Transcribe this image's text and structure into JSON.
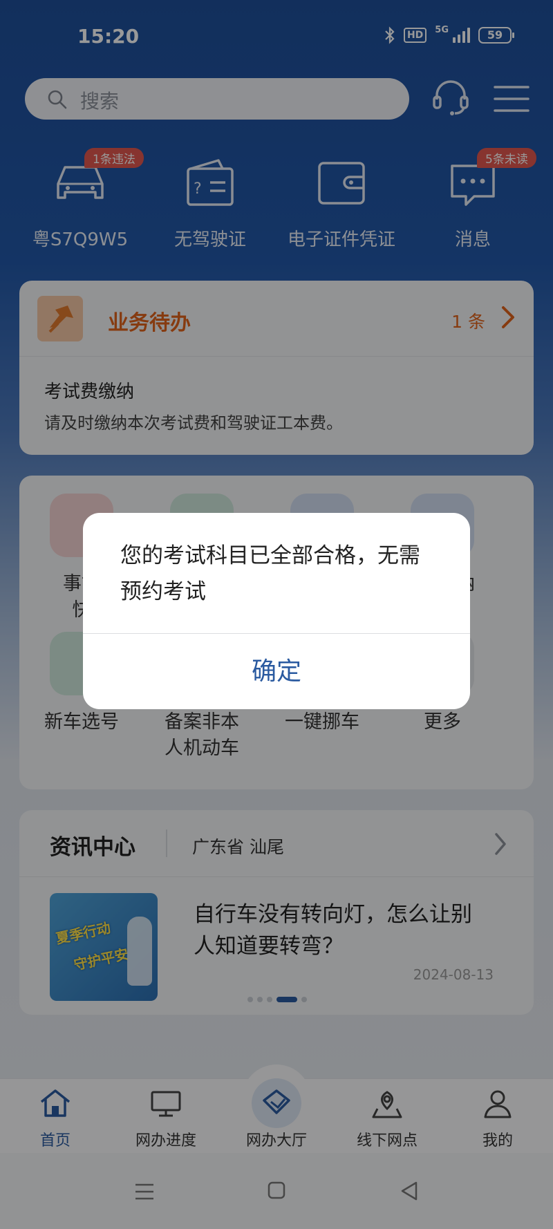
{
  "status_bar": {
    "time": "15:20",
    "hd": "HD",
    "network": "5G",
    "battery": "59"
  },
  "header": {
    "search_placeholder": "搜索",
    "icons": [
      "headset-icon",
      "menu-icon"
    ]
  },
  "quick_entries": [
    {
      "label": "粤S7Q9W5",
      "icon": "car-icon",
      "badge": "1条违法"
    },
    {
      "label": "无驾驶证",
      "icon": "license-icon",
      "badge": ""
    },
    {
      "label": "电子证件凭证",
      "icon": "wallet-icon",
      "badge": ""
    },
    {
      "label": "消息",
      "icon": "message-icon",
      "badge": "5条未读"
    }
  ],
  "todo": {
    "title": "业务待办",
    "count": "1 条",
    "item_title": "考试费缴纳",
    "item_desc": "请及时缴纳本次考试费和驾驶证工本费。"
  },
  "services": [
    {
      "label": "事故",
      "label2": "快",
      "icon": "accident-icon",
      "color": "#f3d2d2"
    },
    {
      "label": "",
      "label2": "",
      "icon": "service-icon-2",
      "color": "#cfe8dc"
    },
    {
      "label": "",
      "label2": "",
      "icon": "service-icon-3",
      "color": "#d3def2"
    },
    {
      "label": "缴纳",
      "label2": "",
      "icon": "payment-icon",
      "color": "#d3def2"
    },
    {
      "label": "新车选号",
      "label2": "",
      "icon": "plate-icon",
      "color": "#cfe8dc"
    },
    {
      "label": "备案非本",
      "label2": "人机动车",
      "icon": "record-icon",
      "color": "#d3def2"
    },
    {
      "label": "一键挪车",
      "label2": "",
      "icon": "move-car-icon",
      "color": "#d3def2"
    },
    {
      "label": "更多",
      "label2": "",
      "icon": "more-icon",
      "color": "#e2e4e8"
    }
  ],
  "news": {
    "title": "资讯中心",
    "region": "广东省 汕尾",
    "thumb_text_1": "夏季行动",
    "thumb_text_2": "守护平安",
    "headline": "自行车没有转向灯，怎么让别人知道要转弯？",
    "date": "2024-08-13",
    "page_count": 5,
    "active_page": 3
  },
  "bottom_nav": [
    {
      "label": "首页",
      "icon": "home-icon",
      "active": true
    },
    {
      "label": "网办进度",
      "icon": "monitor-icon",
      "active": false
    },
    {
      "label": "网办大厅",
      "icon": "hall-icon",
      "active": false
    },
    {
      "label": "线下网点",
      "icon": "location-icon",
      "active": false
    },
    {
      "label": "我的",
      "icon": "person-icon",
      "active": false
    }
  ],
  "dialog": {
    "message": "您的考试科目已全部合格，无需预约考试",
    "confirm_label": "确定"
  },
  "colors": {
    "primary": "#2a5aa0",
    "accent_orange": "#e0631b",
    "badge_red": "#e2574f"
  }
}
